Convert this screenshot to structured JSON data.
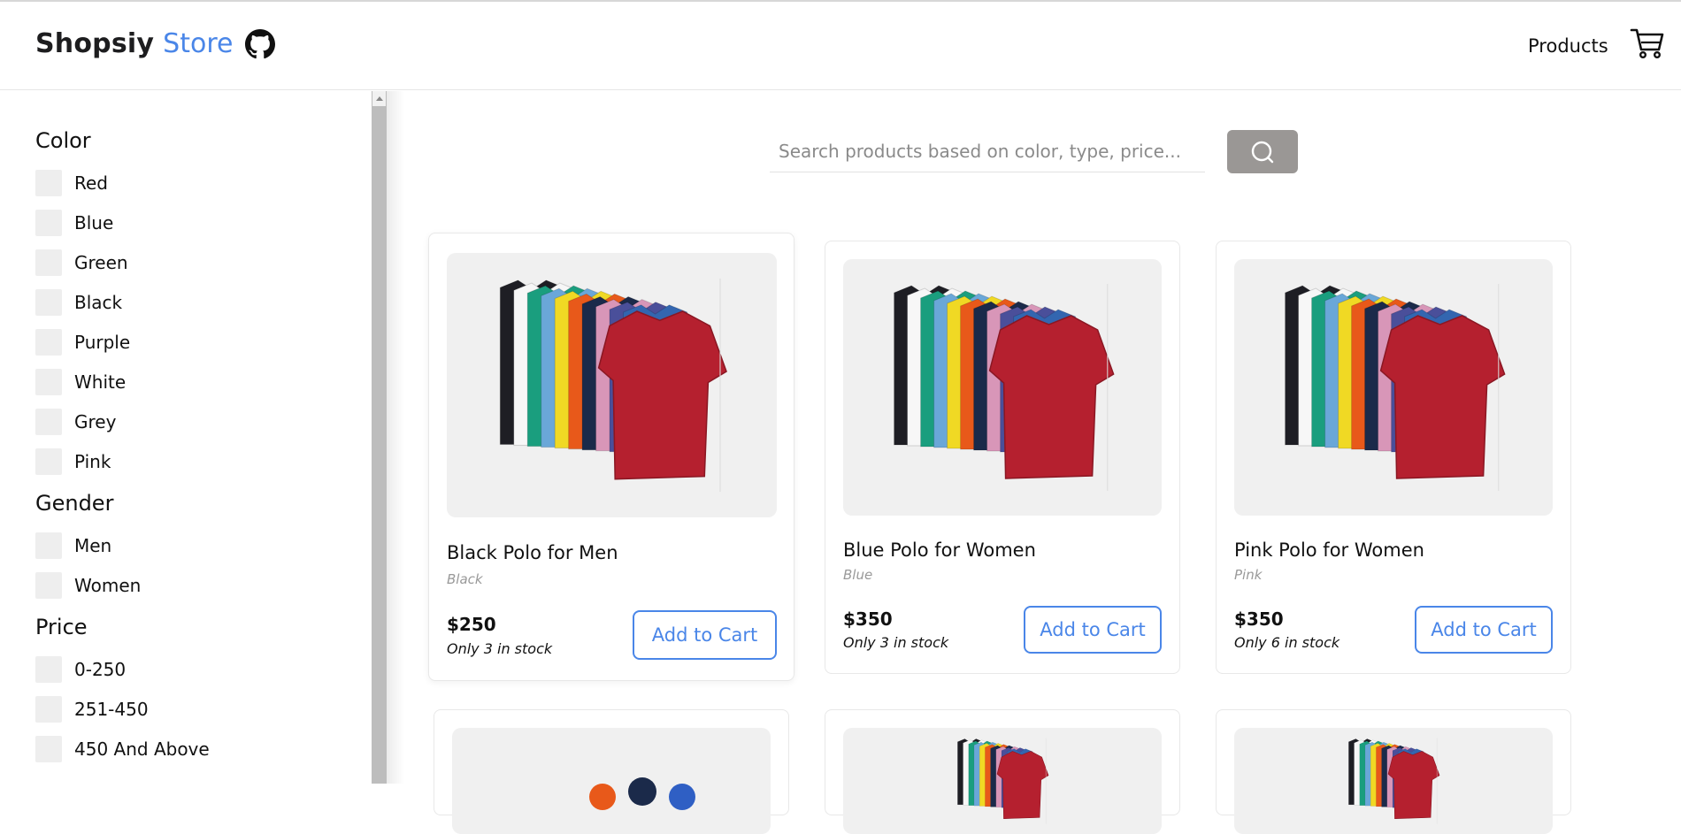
{
  "header": {
    "brand_primary": "Shopsiy",
    "brand_secondary": "Store",
    "nav_products": "Products",
    "icons": [
      "github-icon",
      "cart-icon"
    ]
  },
  "filters": {
    "color": {
      "title": "Color",
      "options": [
        "Red",
        "Blue",
        "Green",
        "Black",
        "Purple",
        "White",
        "Grey",
        "Pink"
      ]
    },
    "gender": {
      "title": "Gender",
      "options": [
        "Men",
        "Women"
      ]
    },
    "price": {
      "title": "Price",
      "options": [
        "0-250",
        "251-450",
        "450 And Above"
      ]
    }
  },
  "search": {
    "placeholder": "Search products based on color, type, price...",
    "value": ""
  },
  "products": [
    {
      "name": "Black Polo for Men",
      "color": "Black",
      "price": "$250",
      "stock": "Only 3 in stock",
      "button": "Add to Cart"
    },
    {
      "name": "Blue Polo for Women",
      "color": "Blue",
      "price": "$350",
      "stock": "Only 3 in stock",
      "button": "Add to Cart"
    },
    {
      "name": "Pink Polo for Women",
      "color": "Pink",
      "price": "$350",
      "stock": "Only 6 in stock",
      "button": "Add to Cart"
    }
  ],
  "colors": {
    "accent": "#4a86e8",
    "search_button": "#9a9795",
    "checkbox": "#eeeeee",
    "image_bg": "#f0f0f0"
  }
}
